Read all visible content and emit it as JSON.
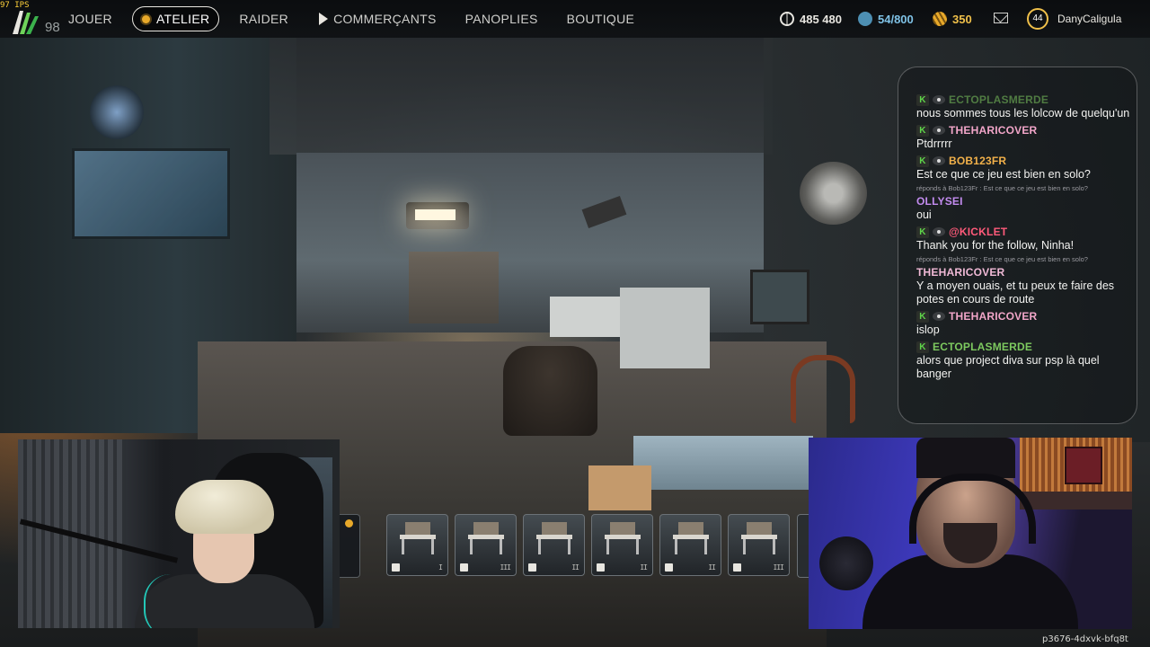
{
  "topbar": {
    "fps": "97 IPS",
    "logo_number": "98",
    "nav": [
      {
        "label": "JOUER",
        "active": false
      },
      {
        "label": "ATELIER",
        "active": true
      },
      {
        "label": "RAIDER",
        "active": false
      },
      {
        "label": "COMMERÇANTS",
        "active": false
      },
      {
        "label": "PANOPLIES",
        "active": false
      },
      {
        "label": "BOUTIQUE",
        "active": false
      }
    ],
    "currencies": [
      {
        "name": "credits-icon",
        "value": "485 480",
        "color": "#e8e6e0"
      },
      {
        "name": "stash-icon",
        "value": "54/800",
        "color": "#7fc2e6"
      },
      {
        "name": "gold-icon",
        "value": "350",
        "color": "#f0c04a"
      }
    ],
    "level": "44",
    "username": "DanyCaligula"
  },
  "chat": {
    "messages": [
      {
        "name": "ECTOPLASMERDE",
        "text": "nous sommes tous les lolcow de quelqu'un",
        "name_color": "green",
        "badges": [
          "k-badge",
          "eye-badge"
        ],
        "reply": ""
      },
      {
        "name": "THEHARICOVER",
        "text": "Ptdrrrrr",
        "name_color": "pink",
        "badges": [
          "k-badge",
          "eye-badge"
        ],
        "reply": ""
      },
      {
        "name": "BOB123FR",
        "text": "Est ce que ce jeu est bien en solo?",
        "name_color": "orange",
        "badges": [
          "k-badge",
          "eye-badge"
        ],
        "reply": ""
      },
      {
        "name": "OLLYSEI",
        "text": "oui",
        "name_color": "purple",
        "badges": [],
        "reply": "réponds à Bob123Fr : Est ce que ce jeu est bien en solo?"
      },
      {
        "name": "@KICKLET",
        "text": "Thank you for the follow, Ninha!",
        "name_color": "red",
        "badges": [
          "k-badge",
          "eye-badge"
        ],
        "reply": ""
      },
      {
        "name": "THEHARICOVER",
        "text": "Y a moyen ouais, et tu peux te faire des potes en cours de route",
        "name_color": "lpink",
        "badges": [],
        "reply": "réponds à Bob123Fr : Est ce que ce jeu est bien en solo?"
      },
      {
        "name": "THEHARICOVER",
        "text": "islop",
        "name_color": "pink",
        "badges": [
          "k-badge",
          "eye-badge"
        ],
        "reply": ""
      },
      {
        "name": "ECTOPLASMERDE",
        "text": "alors que project diva sur psp là quel banger",
        "name_color": "green",
        "badges": [
          "k-badge"
        ],
        "reply": ""
      }
    ]
  },
  "hotbar": {
    "slots": [
      {
        "name": "workbench-slot-1",
        "icon": "bed-icon",
        "tier": "I"
      },
      {
        "name": "workbench-slot-2",
        "icon": "gear-icon",
        "tier": "III"
      },
      {
        "name": "workbench-slot-3",
        "icon": "crossed-tools-icon",
        "tier": "II"
      },
      {
        "name": "workbench-slot-4",
        "icon": "medical-cross-icon",
        "tier": "II"
      },
      {
        "name": "workbench-slot-5",
        "icon": "tools-icon",
        "tier": "II"
      },
      {
        "name": "workbench-slot-6",
        "icon": "flask-icon",
        "tier": "III"
      }
    ]
  },
  "overlay": {
    "code": "p3676-4dxvk-bfq8t"
  }
}
